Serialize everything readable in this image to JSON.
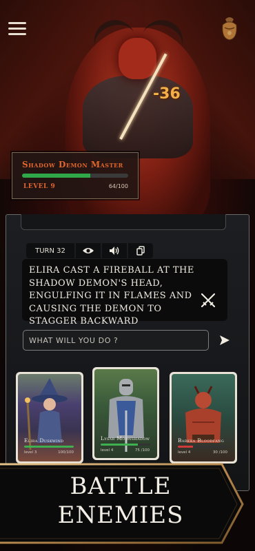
{
  "enemy": {
    "name": "Shadow Demon Master",
    "level_label": "LEVEL 9",
    "hp_text": "64/100",
    "hp_fraction": 0.64,
    "damage_text": "-36"
  },
  "toolbar": {
    "turn_label": "TURN 32"
  },
  "narration": {
    "text": "Elira cast a fireball at the shadow demon's head, engulfing it in flames and causing the demon to stagger backward"
  },
  "action_input": {
    "placeholder": "WHAT WILL YOU DO ?"
  },
  "party": [
    {
      "name": "Elira Duskwind",
      "level": "level 3",
      "hp_text": "100/100",
      "hp_fraction": 1.0,
      "bar_color": "#3fb04f"
    },
    {
      "name": "Lysar Moonshadow",
      "level": "level 4",
      "hp_text": "75 /100",
      "hp_fraction": 0.75,
      "bar_color": "#3fb04f"
    },
    {
      "name": "Barkka Bloodfang",
      "level": "level 4",
      "hp_text": "30 /100",
      "hp_fraction": 0.3,
      "bar_color": "#d13a3a"
    }
  ],
  "banner": {
    "line1": "BATTLE",
    "line2": "ENEMIES"
  },
  "colors": {
    "accent_orange": "#e0662c",
    "hp_green": "#3fb04f",
    "hp_red": "#d13a3a",
    "panel_bg": "#1a1b1e",
    "banner_gold": "#b8894f"
  },
  "icons": [
    "menu-icon",
    "bag-icon",
    "eye-icon",
    "speaker-icon",
    "copy-icon",
    "crossed-swords-icon",
    "send-icon"
  ]
}
